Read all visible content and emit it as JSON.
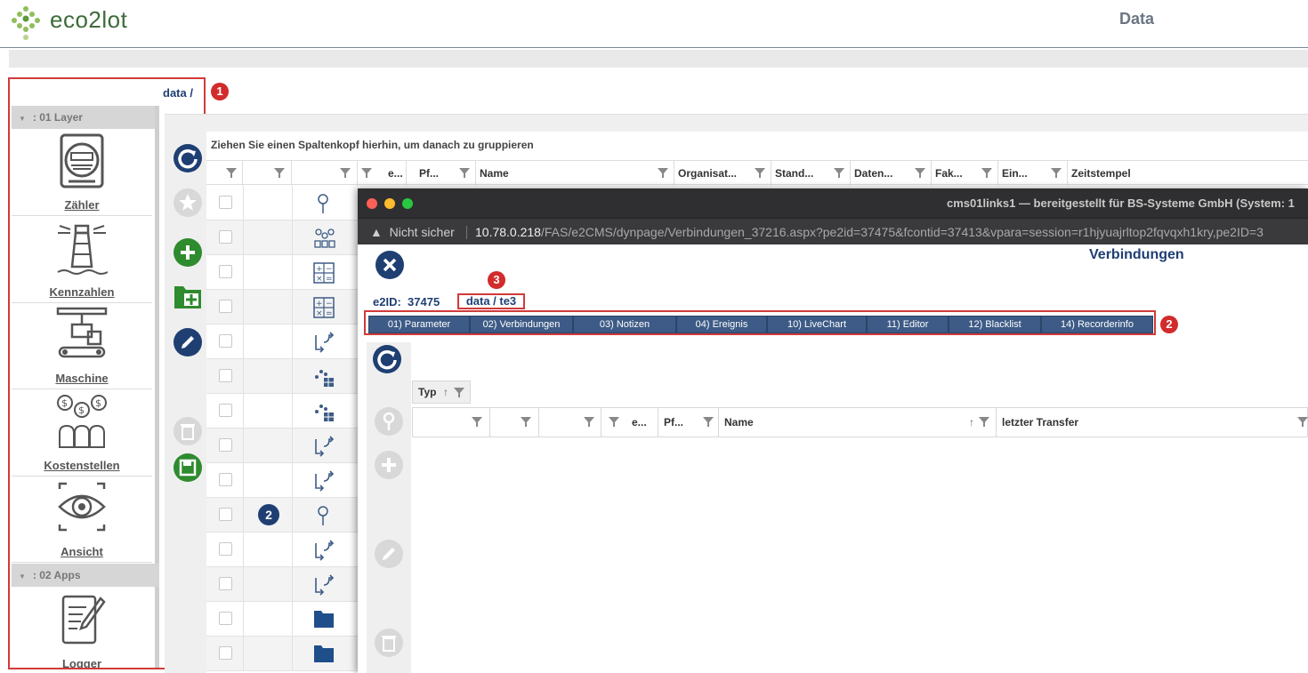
{
  "header": {
    "logo_text": "eco2lot",
    "title": "Data"
  },
  "breadcrumb": "data /",
  "badges": {
    "one": "1",
    "two": "2",
    "three": "3",
    "row_badge": "2"
  },
  "sidebar": {
    "groups": [
      {
        "label": ": 01 Layer"
      },
      {
        "label": ": 02 Apps"
      }
    ],
    "items": [
      {
        "label": "Zähler",
        "icon": "meter-icon"
      },
      {
        "label": "Kennzahlen",
        "icon": "lighthouse-icon"
      },
      {
        "label": "Maschine",
        "icon": "machine-icon"
      },
      {
        "label": "Kostenstellen",
        "icon": "money-bags-icon"
      },
      {
        "label": "Ansicht",
        "icon": "eye-icon"
      },
      {
        "label": "Logger",
        "icon": "notepad-icon"
      }
    ]
  },
  "grid": {
    "group_hint": "Ziehen Sie einen Spaltenkopf hierhin, um danach zu gruppieren",
    "columns": [
      "",
      "",
      "",
      "e...",
      "Pf...",
      "Name",
      "Organisat...",
      "Stand...",
      "Daten...",
      "Fak...",
      "Ein...",
      "Zeitstempel"
    ],
    "row_icons": [
      "pin-icon",
      "network-icon",
      "calculator-icon",
      "calculator-icon",
      "connector-icon",
      "chart-icon",
      "chart-icon",
      "connector-icon",
      "connector-icon",
      "pin-icon",
      "connector-icon",
      "connector-icon",
      "folder-icon",
      "folder-icon"
    ]
  },
  "popup": {
    "window_title": "cms01links1 — bereitgestellt für BS-Systeme GmbH (System: 1",
    "not_secure": "Nicht sicher",
    "url_host": "10.78.0.218",
    "url_path": "/FAS/e2CMS/dynpage/Verbindungen_37216.aspx?pe2id=37475&fcontid=37413&vpara=session=r1hjyuajrltop2fqvqxh1kry,pe2ID=3",
    "heading": "Verbindungen",
    "e2id_label": "e2ID:",
    "e2id_value": "37475",
    "breadcrumb": "data / te3",
    "tabs": [
      "01) Parameter",
      "02) Verbindungen",
      "03) Notizen",
      "04) Ereignis",
      "10) LiveChart",
      "11) Editor",
      "12) Blacklist",
      "14) Recorderinfo"
    ],
    "typ_label": "Typ",
    "columns": [
      "",
      "",
      "",
      "e...",
      "Pf...",
      "Name",
      "letzter Transfer"
    ]
  },
  "colors": {
    "accent": "#1f3f73",
    "highlight_red": "#d23a3a",
    "tab_blue": "#3d5b86",
    "green": "#2e8b2e"
  }
}
